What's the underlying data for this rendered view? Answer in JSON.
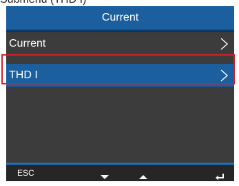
{
  "caption": "Submenu (THD I)",
  "header": {
    "title": "Current"
  },
  "menu": {
    "items": [
      {
        "label": "Current",
        "selected": false
      },
      {
        "label": "THD I",
        "selected": true
      }
    ]
  },
  "softkeys": {
    "esc": "ESC",
    "icons": [
      "down-triangle-icon",
      "up-triangle-icon",
      "enter-icon"
    ]
  },
  "colors": {
    "title_bar": "#1c5f9f",
    "selected_row": "#1c5f9f",
    "highlight_frame": "#d0202a",
    "screen_bg": "#3c3c3c"
  }
}
